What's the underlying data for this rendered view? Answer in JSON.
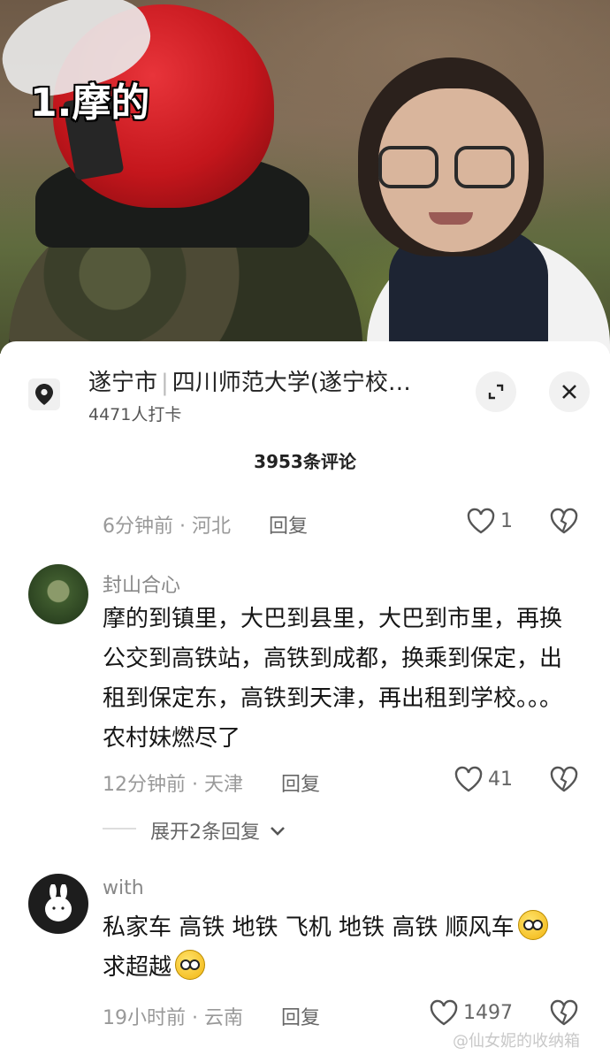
{
  "video": {
    "overlay_label": "1.摩的"
  },
  "location": {
    "city": "遂宁市",
    "place": "四川师范大学(遂宁校…",
    "checkins": "4471人打卡"
  },
  "comments_header": {
    "count_label": "3953条评论"
  },
  "reply_label": "回复",
  "comments": [
    {
      "meta": "6分钟前 · 河北",
      "likes": "1"
    },
    {
      "username": "封山合心",
      "text": "摩的到镇里，大巴到县里，大巴到市里，再换公交到高铁站，高铁到成都，换乘到保定，出租到保定东，高铁到天津，再出租到学校。。。农村妹燃尽了",
      "meta": "12分钟前 · 天津",
      "likes": "41",
      "expand_label": "展开2条回复"
    },
    {
      "username": "with",
      "text_line1": "私家车 高铁 地铁 飞机 地铁 高铁 顺风车",
      "text_line2": "求超越",
      "meta": "19小时前 · 云南",
      "likes": "1497"
    }
  ],
  "watermark": "@仙女妮的收纳箱",
  "icons": [
    "location-pin-icon",
    "expand-icon",
    "close-icon",
    "heart-icon",
    "broken-heart-icon",
    "chevron-down-icon",
    "emoji-smile-icon",
    "emoji-wink-icon"
  ]
}
